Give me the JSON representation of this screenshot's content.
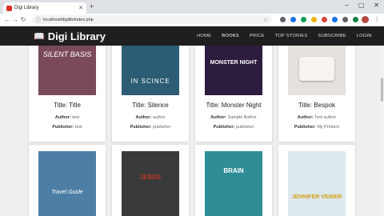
{
  "browser": {
    "tab_title": "Digi Library",
    "url": "localhost/digilib/index.php"
  },
  "site": {
    "brand": "Digi Library",
    "nav": [
      "HOME",
      "BOOKS",
      "PRICE",
      "TOP STORIES",
      "SUBSCRIBE",
      "LOGIN"
    ]
  },
  "books": [
    {
      "title": "Title: Title",
      "author_label": "Author:",
      "author": "test",
      "publisher_label": "Publisher:",
      "publisher": "test",
      "cover_text": "SILENT BASIS",
      "cover_color": "#7b4a58"
    },
    {
      "title": "Title: Silence",
      "author_label": "Author:",
      "author": "author",
      "publisher_label": "Publisher:",
      "publisher": "publisher",
      "cover_text": "IN SCINCE",
      "cover_color": "#2c5d74"
    },
    {
      "title": "Title: Monster Night",
      "author_label": "Author:",
      "author": "Sample Author",
      "publisher_label": "Publisher:",
      "publisher": "publisher",
      "cover_text": "MONSTER NIGHT",
      "cover_color": "#2c1d3e"
    },
    {
      "title": "Title: Bespok",
      "author_label": "Author:",
      "author": "Test author",
      "publisher_label": "Publisher:",
      "publisher": "My Printers",
      "cover_text": "",
      "cover_color": "#e6e1dc"
    },
    {
      "cover_text": "Travel Guide",
      "cover_color": "#4d7fa6"
    },
    {
      "cover_text": "JESUS",
      "cover_color": "#3a3a3a"
    },
    {
      "cover_text": "BRAIN",
      "cover_color": "#2f8d96"
    },
    {
      "cover_text": "JENNIFER VEINER",
      "cover_color": "#dde9ee"
    }
  ]
}
